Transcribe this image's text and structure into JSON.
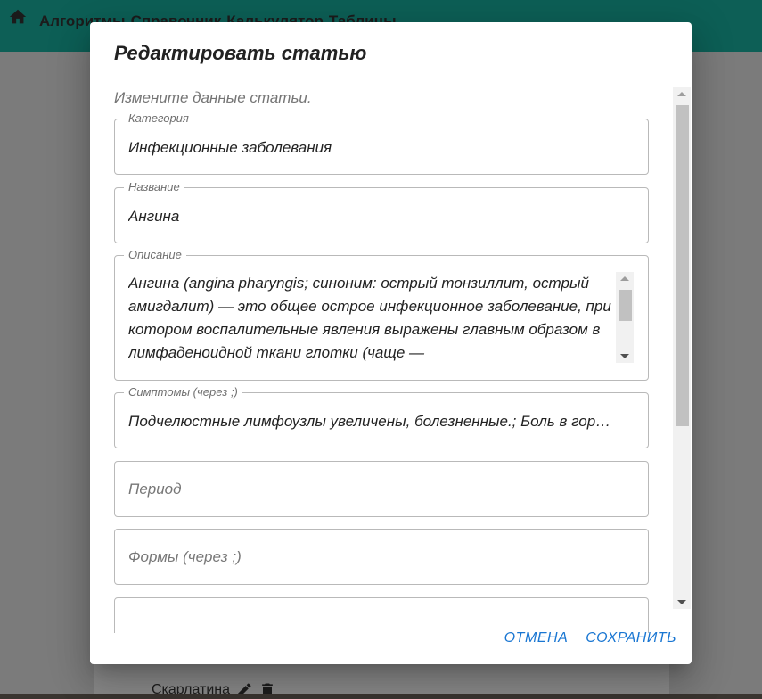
{
  "app": {
    "nav": [
      "Алгоритмы",
      "Справочник",
      "Калькулятор",
      "Таблицы"
    ],
    "background_item": "Скарлатина"
  },
  "dialog": {
    "title": "Редактировать статью",
    "subtitle": "Измените данные статьи.",
    "fields": {
      "category": {
        "label": "Категория",
        "value": "Инфекционные заболевания"
      },
      "name": {
        "label": "Название",
        "value": "Ангина"
      },
      "description": {
        "label": "Описание",
        "value": "Ангина (angina pharyngis; синоним: острый тонзиллит, острый амигдалит) — это общее острое инфекционное заболевание, при котором воспалительные явления выражены главным образом в лимфаденоидной ткани глотки (чаще —"
      },
      "symptoms": {
        "label": "Симптомы (через ;)",
        "value": "Подчелюстные лимфоузлы увеличены, болезненные.; Боль в гор…"
      },
      "period": {
        "placeholder": "Период"
      },
      "forms": {
        "placeholder": "Формы (через ;)"
      }
    },
    "actions": {
      "cancel": "Отмена",
      "save": "Сохранить"
    }
  },
  "colors": {
    "app_bar": "#0d5f56",
    "accent": "#1976d2"
  }
}
